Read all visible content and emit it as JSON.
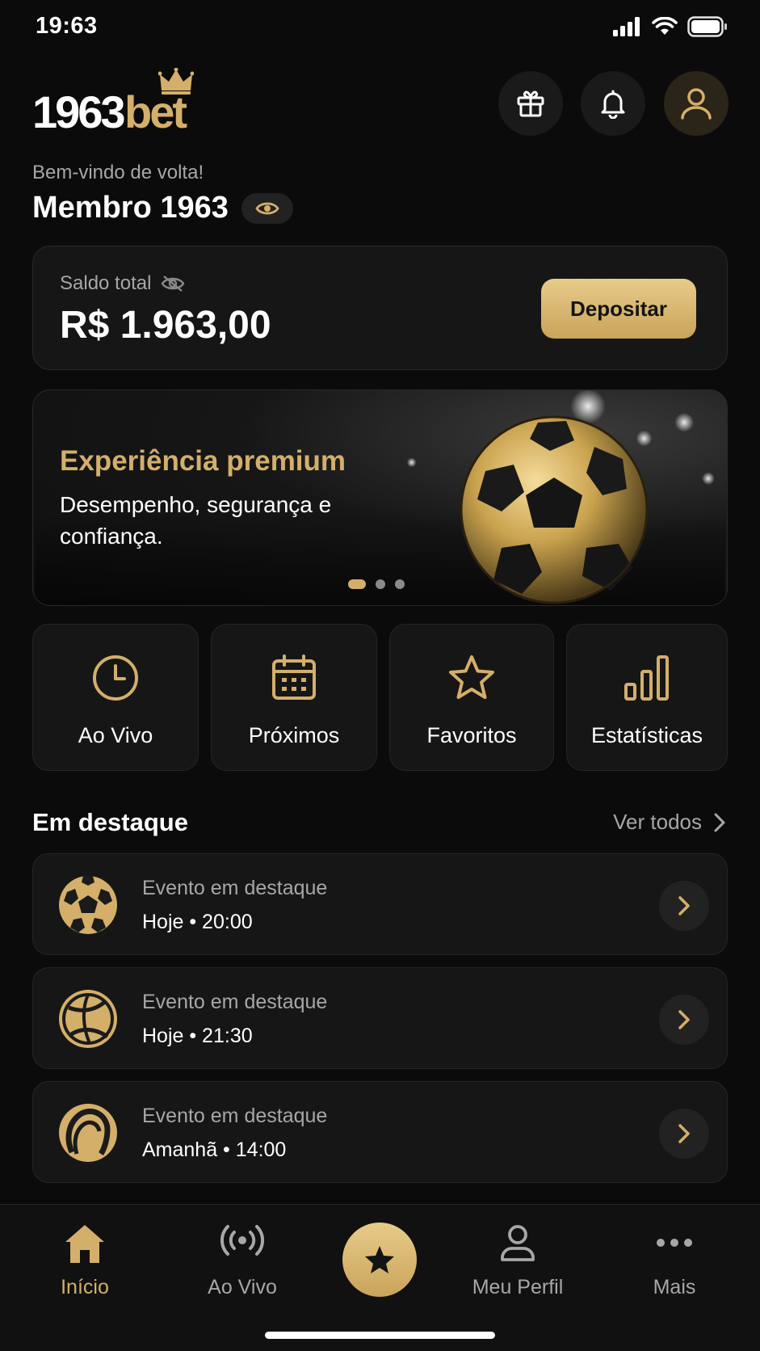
{
  "status_bar": {
    "time": "19:63"
  },
  "brand": {
    "logo_number": "1963",
    "logo_suffix": "bet",
    "accent_color": "#d4af6a"
  },
  "header": {
    "icons": [
      "gift-icon",
      "bell-icon",
      "user-icon"
    ]
  },
  "greeting": {
    "welcome": "Bem-vindo de volta!",
    "member_name": "Membro 1963"
  },
  "balance": {
    "label": "Saldo total",
    "value": "R$ 1.963,00",
    "deposit_label": "Depositar"
  },
  "banner": {
    "title": "Experiência premium",
    "subtitle": "Desempenho, segurança e confiança.",
    "slide_count": 3,
    "active_slide": 1
  },
  "quick_actions": [
    {
      "label": "Ao Vivo",
      "icon": "clock-icon"
    },
    {
      "label": "Próximos",
      "icon": "calendar-icon"
    },
    {
      "label": "Favoritos",
      "icon": "star-icon"
    },
    {
      "label": "Estatísticas",
      "icon": "bar-chart-icon"
    }
  ],
  "featured": {
    "title": "Em destaque",
    "see_all": "Ver todos",
    "events": [
      {
        "title": "Evento em destaque",
        "time": "Hoje • 20:00",
        "icon": "soccer-ball-icon"
      },
      {
        "title": "Evento em destaque",
        "time": "Hoje • 21:30",
        "icon": "basketball-icon"
      },
      {
        "title": "Evento em destaque",
        "time": "Amanhã • 14:00",
        "icon": "tennis-ball-icon"
      }
    ]
  },
  "tabbar": {
    "items": [
      {
        "label": "Início",
        "icon": "home-icon",
        "active": true
      },
      {
        "label": "Ao Vivo",
        "icon": "live-broadcast-icon",
        "active": false
      },
      {
        "label": "",
        "icon": "star-icon",
        "active": false
      },
      {
        "label": "Meu Perfil",
        "icon": "user-icon",
        "active": false
      },
      {
        "label": "Mais",
        "icon": "more-dots-icon",
        "active": false
      }
    ]
  }
}
